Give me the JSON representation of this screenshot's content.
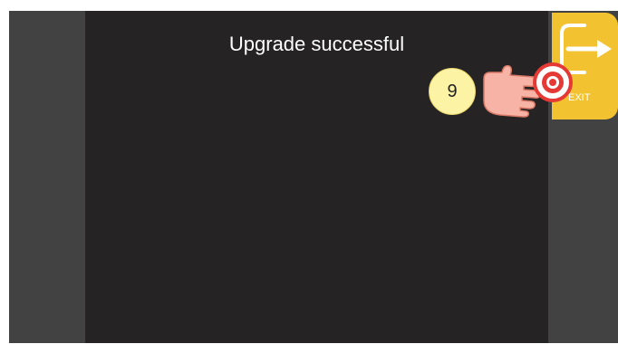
{
  "screen": {
    "message": "Upgrade successful"
  },
  "exit_button": {
    "label": "EXIT",
    "icon": "exit-arrow-icon"
  },
  "tutorial": {
    "step_number": "9",
    "pointer_icon": "hand-pointer-icon",
    "target_icon": "tap-target-icon"
  },
  "colors": {
    "panel_background": "#252323",
    "side_background": "#424242",
    "exit_accent": "#f2c230",
    "badge_fill": "#fdf3a5",
    "tap_ring": "#e53935"
  }
}
